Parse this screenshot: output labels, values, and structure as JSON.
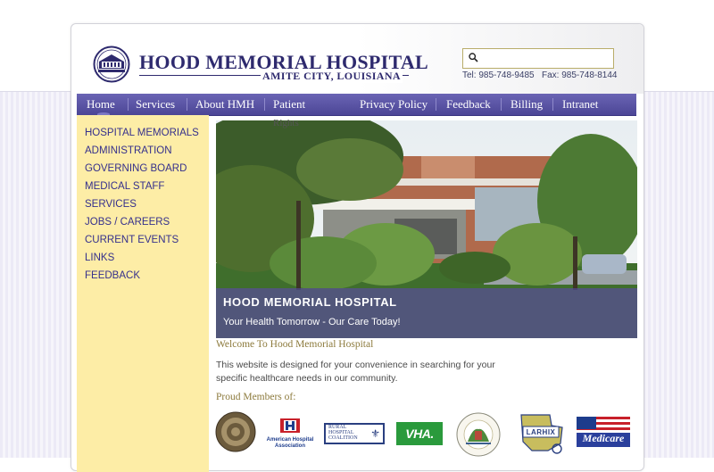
{
  "header": {
    "hospital_name": "HOOD MEMORIAL HOSPITAL",
    "city": "AMITE CITY, LOUISIANA",
    "search_placeholder": "",
    "phone": "Tel: 985-748-9485",
    "fax": "Fax: 985-748-8144"
  },
  "nav": {
    "items": [
      {
        "label": "Home"
      },
      {
        "label": "Services"
      },
      {
        "label": "About HMH"
      },
      {
        "label": "Patient"
      },
      {
        "label": "Privacy Policy"
      },
      {
        "label": "Feedback"
      },
      {
        "label": "Billing"
      },
      {
        "label": "Intranet"
      }
    ],
    "overflow_text": "Rights"
  },
  "sidebar": {
    "items": [
      {
        "label": "HOSPITAL MEMORIALS"
      },
      {
        "label": "ADMINISTRATION"
      },
      {
        "label": "GOVERNING BOARD"
      },
      {
        "label": "MEDICAL STAFF"
      },
      {
        "label": "SERVICES"
      },
      {
        "label": "JOBS / CAREERS"
      },
      {
        "label": "CURRENT EVENTS"
      },
      {
        "label": "LINKS"
      },
      {
        "label": "FEEDBACK"
      }
    ]
  },
  "hero": {
    "title": "HOOD MEMORIAL HOSPITAL",
    "subtitle": "Your Health Tomorrow - Our Care Today!"
  },
  "content": {
    "welcome": "Welcome To Hood Memorial Hospital",
    "intro": "This website is designed for your convenience in searching for your specific healthcare needs in our community.",
    "members_heading": "Proud Members of:"
  },
  "members": {
    "aha_line1": "American Hospital",
    "aha_line2": "Association",
    "rural_line1": "RURAL",
    "rural_line2": "HOSPITAL",
    "rural_line3": "COALITION",
    "vha": "VHA.",
    "lrha": "LOUISIANA RURAL HEALTH ASSOCIATION",
    "larhix": "LARHIX",
    "medicare": "Medicare"
  },
  "colors": {
    "brand_navy": "#2e2a6e",
    "nav_purple": "#5a54a6",
    "sidebar_yellow": "#fdeda6",
    "link_blue": "#35308c",
    "heading_gold": "#8c7a3c"
  }
}
